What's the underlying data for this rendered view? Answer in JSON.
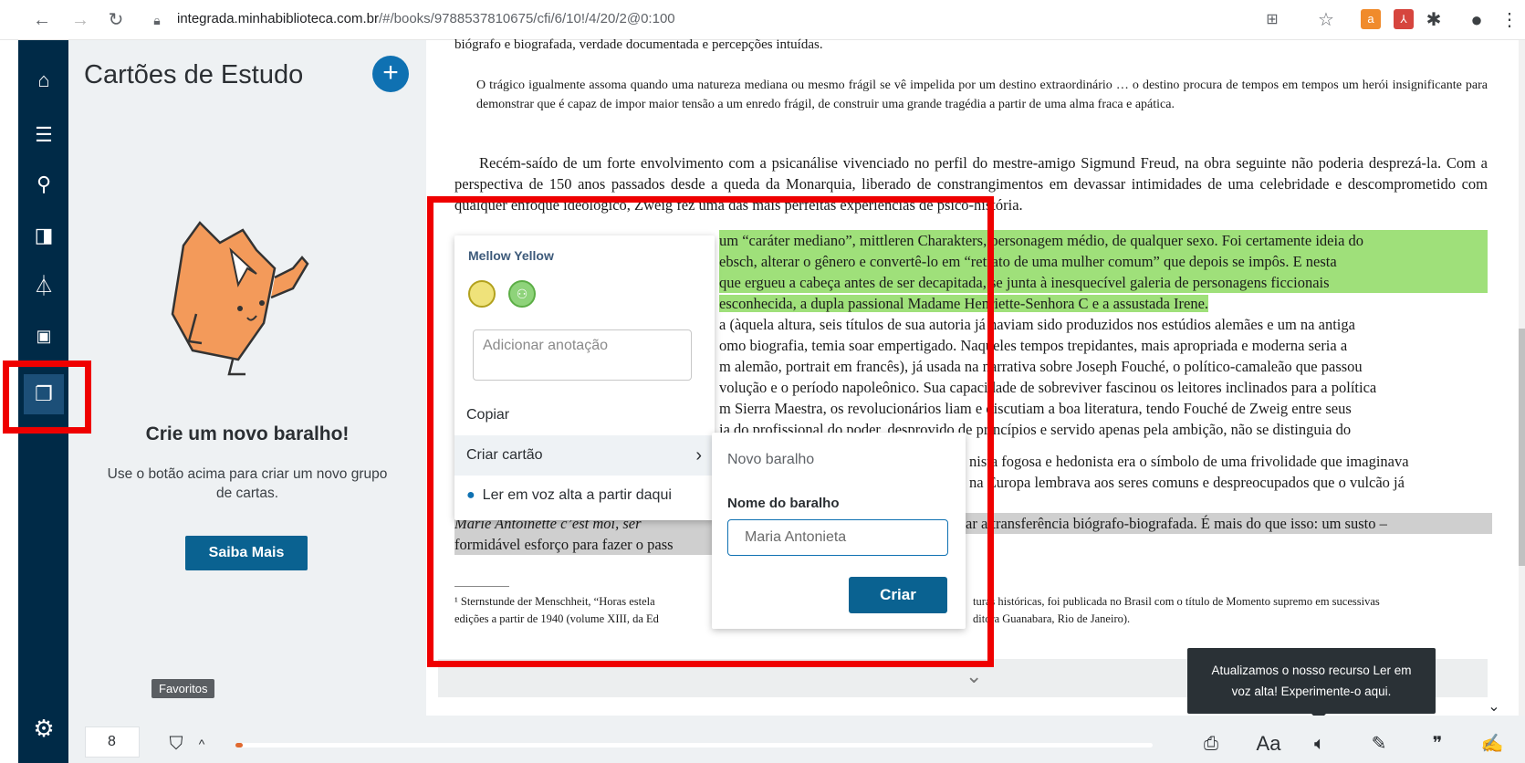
{
  "browser": {
    "url_host": "integrada.minhabiblioteca.com.br",
    "url_path": "/#/books/9788537810675/cfi/6/10!/4/20/2@0:100"
  },
  "panel": {
    "title": "Cartões de Estudo",
    "add_label": "+",
    "empty_title": "Crie um novo baralho!",
    "empty_desc": "Use o botão acima para criar um novo grupo de cartas.",
    "more_label": "Saiba Mais",
    "favorites_tooltip": "Favoritos"
  },
  "reader": {
    "top_fragment": "biógrafo e biografada, verdade documentada e percepções intuídas.",
    "quote": "O trágico igualmente assoma quando uma natureza mediana ou mesmo frágil se vê impelida por um destino extraordinário … o destino procura de tempos em tempos um herói insignificante para demonstrar que é capaz de impor maior tensão a um enredo frágil, de construir uma grande tragédia a partir de uma alma fraca e apática.",
    "para1": "Recém-saído de um forte envolvimento com a psicanálise vivenciado no perfil do mestre-amigo Sigmund Freud, na obra seguinte não poderia desprezá-la. Com a perspectiva de 150 anos passados desde a queda da Monarquia, liberado de constrangimentos em devassar intimidades de uma celebridade e descomprometido com qualquer enfoque ideológico, Zweig fez uma das mais perfeitas experiências de psico-história.",
    "hl_line1": "um “caráter mediano”, mittleren Charakters, personagem médio, de qualquer sexo. Foi certamente ideia do",
    "hl_line2": "ebsch, alterar o gênero e convertê-lo em “retrato de uma mulher comum” que depois se impôs. E nesta",
    "hl_line3": "que ergueu a cabeça antes de ser decapitada, se junta à inesquecível galeria de personagens ficcionais",
    "hl_line4": "esconhecida, a dupla passional Madame Henriette-Senhora C e a assustada Irene.",
    "line5": "a (àquela altura, seis títulos de sua autoria já haviam sido produzidos nos estúdios alemães e um na antiga",
    "line6": "omo biografia, temia soar empertigado. Naqueles tempos trepidantes, mais apropriada e moderna seria a",
    "line7": "m alemão, portrait em francês), já usada na narrativa sobre Joseph Fouché, o político-camaleão que passou",
    "line8": "volução e o período napoleônico. Sua capacidade de sobreviver fascinou os leitores inclinados para a política",
    "line9": "m Sierra Maestra, os revolucionários liam e discutiam a boa literatura, tendo Fouché de Zweig entre seus",
    "line10": "ia do profissional do poder, desprovido de princípios e servido apenas pela ambição, não se distinguia do",
    "line11": "nista fogosa e hedonista era o símbolo de uma frivolidade que imaginava",
    "line12": "na Europa lembrava aos seres comuns e despreocupados que o vulcão já",
    "gray1": "Marie Antoinette c’est moi, ser",
    "gray1b": "ar a transferência biógrafo-biografada. É mais do que isso: um susto –",
    "gray2": "formidável esforço para fazer o pass",
    "foot1a": "¹ Sternstunde der Menschheit, “Horas estela",
    "foot1b": "turas históricas, foi publicada no Brasil com o título de Momento supremo em sucessivas",
    "foot2a": "edições a partir de 1940 (volume XIII, da Ed",
    "foot2b": "ditora Guanabara, Rio de Janeiro)."
  },
  "popup": {
    "swatch_title": "Mellow Yellow",
    "note_placeholder": "Adicionar anotação",
    "copy_label": "Copiar",
    "create_card_label": "Criar cartão",
    "read_aloud_label": "Ler em voz alta a partir daqui"
  },
  "submenu": {
    "new_deck_label": "Novo baralho",
    "deck_name_label": "Nome do baralho",
    "deck_name_value": "Maria Antonieta",
    "create_label": "Criar"
  },
  "toast": {
    "line1": "Atualizamos o nosso recurso Ler em",
    "line2": "voz alta! Experimente-o aqui."
  },
  "toolbar": {
    "page_number": "8",
    "progress_fraction": 0.008
  },
  "colors": {
    "rail": "#002a47",
    "accent": "#0f71b2",
    "highlight_green": "#9fe07a",
    "annotation_red": "#ef0000"
  }
}
